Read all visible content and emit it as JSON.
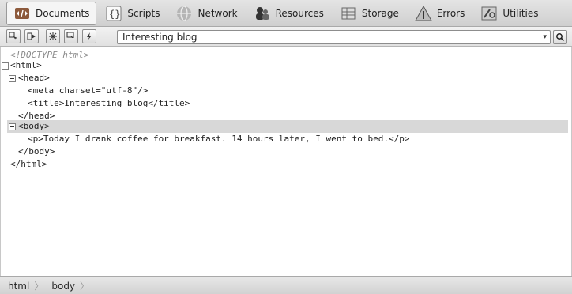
{
  "tabs": [
    {
      "label": "Documents",
      "icon": "documents-icon",
      "active": true
    },
    {
      "label": "Scripts",
      "icon": "scripts-icon",
      "active": false
    },
    {
      "label": "Network",
      "icon": "network-icon",
      "active": false
    },
    {
      "label": "Resources",
      "icon": "resources-icon",
      "active": false
    },
    {
      "label": "Storage",
      "icon": "storage-icon",
      "active": false
    },
    {
      "label": "Errors",
      "icon": "errors-icon",
      "active": false
    },
    {
      "label": "Utilities",
      "icon": "utilities-icon",
      "active": false
    }
  ],
  "toolbar": {
    "buttons": [
      "select-element-icon",
      "open-node-icon",
      "spotlight-icon",
      "pick-icon",
      "refresh-icon"
    ],
    "document_select": "Interesting blog",
    "search_icon": "search-icon"
  },
  "tree": {
    "doctype": "<!DOCTYPE html>",
    "html_open": "<html>",
    "head_open": "<head>",
    "meta": "<meta charset=\"utf-8\"/>",
    "title": "<title>Interesting blog</title>",
    "head_close": "</head>",
    "body_open": "<body>",
    "p": "<p>Today I drank coffee for breakfast. 14 hours later, I went to bed.</p>",
    "body_close": "</body>",
    "html_close": "</html>"
  },
  "statusbar": {
    "crumbs": [
      "html",
      "body"
    ]
  },
  "colors": {
    "selection": "#d8d8d8",
    "comment": "#8a8a8a"
  }
}
